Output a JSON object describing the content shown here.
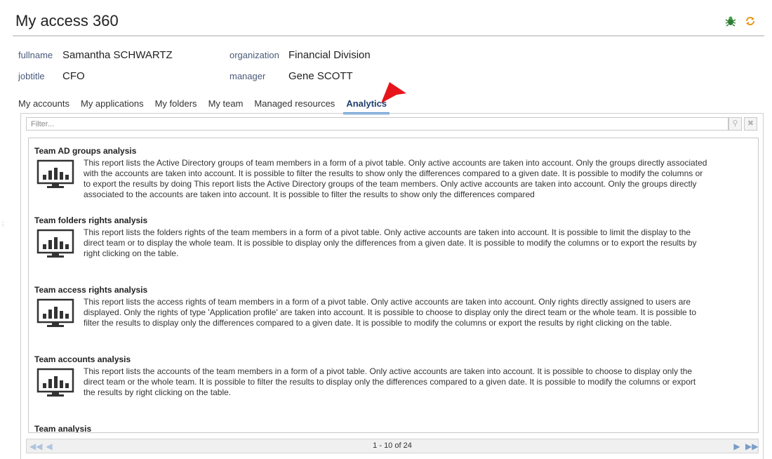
{
  "header": {
    "title": "My access 360"
  },
  "profile": {
    "fullname_label": "fullname",
    "fullname": "Samantha SCHWARTZ",
    "organization_label": "organization",
    "organization": "Financial Division",
    "jobtitle_label": "jobtitle",
    "jobtitle": "CFO",
    "manager_label": "manager",
    "manager": "Gene SCOTT"
  },
  "tabs": [
    {
      "label": "My accounts"
    },
    {
      "label": "My applications"
    },
    {
      "label": "My folders"
    },
    {
      "label": "My team"
    },
    {
      "label": "Managed resources"
    },
    {
      "label": "Analytics",
      "active": true
    }
  ],
  "filter": {
    "placeholder": "Filter..."
  },
  "reports": [
    {
      "title": "Team AD groups analysis",
      "description": "This report lists the Active Directory groups of team members in a form of a pivot table. Only active accounts are taken into account. Only the groups directly associated with the accounts are taken into account. It is possible to filter the results to show only the differences compared to a given date. It is possible to modify the columns or to export the results by doing This report lists the Active Directory groups of the team members. Only active accounts are taken into account. Only the groups directly associated to the accounts are taken into account. It is possible to filter the results to show only the differences compared"
    },
    {
      "title": "Team folders rights analysis",
      "description": "This report lists the folders rights of the team members in a form of a pivot table. Only active accounts are taken into account. It is possible to limit the display to the direct team or to display the whole team. It is possible to display only the differences from a given date. It is possible to modify the columns or to export the results by right clicking on the table."
    },
    {
      "title": "Team access rights analysis",
      "description": "This report lists the access rights of team members in a form of a pivot table. Only active accounts are taken into account. Only rights directly assigned to users are displayed. Only the rights of type 'Application profile' are taken into account. It is possible to choose to display only the direct team or the whole team. It is possible to filter the results to display only the differences compared to a given date. It is possible to modify the columns or export the results by right clicking on the table."
    },
    {
      "title": "Team accounts analysis",
      "description": "This report lists the accounts of the team members in a form of a pivot table. Only active accounts are taken into account. It is possible to choose to display only the direct team or the whole team. It is possible to filter the results to display only the differences compared to a given date. It is possible to modify the columns or export the results by right clicking on the table."
    },
    {
      "title": "Team analysis",
      "description": ""
    }
  ],
  "pager": {
    "count": "1 - 10 of 24"
  },
  "colors": {
    "accent": "#4a90d9",
    "pointer": "#e8141b"
  },
  "icons": [
    "bug-icon",
    "refresh-icon",
    "chart-monitor-icon",
    "search-icon",
    "clear-icon",
    "first-page-icon",
    "prev-page-icon",
    "next-page-icon",
    "last-page-icon"
  ]
}
